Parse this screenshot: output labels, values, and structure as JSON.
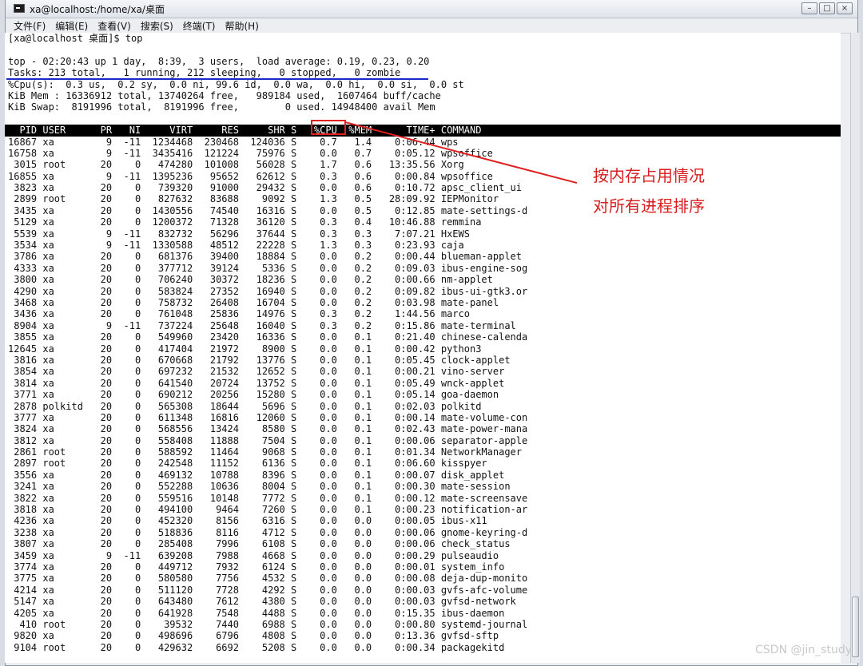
{
  "window": {
    "title": "xa@localhost:/home/xa/桌面",
    "buttons": [
      "–",
      "□",
      "×"
    ]
  },
  "menu": [
    "文件(F)",
    "编辑(E)",
    "查看(V)",
    "搜索(S)",
    "终端(T)",
    "帮助(H)"
  ],
  "terminal": {
    "prompt": "[xa@localhost 桌面]$ top",
    "summary": [
      "top - 02:20:43 up 1 day,  8:39,  3 users,  load average: 0.19, 0.23, 0.20",
      "Tasks: 213 total,   1 running, 212 sleeping,   0 stopped,   0 zombie",
      "%Cpu(s):  0.3 us,  0.2 sy,  0.0 ni, 99.6 id,  0.0 wa,  0.0 hi,  0.0 si,  0.0 st",
      "KiB Mem : 16336912 total, 13740264 free,   989184 used,  1607464 buff/cache",
      "KiB Swap:  8191996 total,  8191996 free,        0 used. 14948400 avail Mem"
    ],
    "columns": [
      "PID",
      "USER",
      "PR",
      "NI",
      "VIRT",
      "RES",
      "SHR",
      "S",
      "%CPU",
      "%MEM",
      "TIME+",
      "COMMAND"
    ],
    "rows": [
      [
        "16867",
        "xa",
        "9",
        "-11",
        "1234468",
        "230468",
        "124036",
        "S",
        "0.7",
        "1.4",
        "0:06.44",
        "wps"
      ],
      [
        "16758",
        "xa",
        "9",
        "-11",
        "3435416",
        "121224",
        "75976",
        "S",
        "0.0",
        "0.7",
        "0:05.12",
        "wpsoffice"
      ],
      [
        "3015",
        "root",
        "20",
        "0",
        "474280",
        "101008",
        "56028",
        "S",
        "1.7",
        "0.6",
        "13:35.56",
        "Xorg"
      ],
      [
        "16855",
        "xa",
        "9",
        "-11",
        "1395236",
        "95652",
        "62612",
        "S",
        "0.3",
        "0.6",
        "0:00.84",
        "wpsoffice"
      ],
      [
        "3823",
        "xa",
        "20",
        "0",
        "739320",
        "91000",
        "29432",
        "S",
        "0.0",
        "0.6",
        "0:10.72",
        "apsc_client_ui"
      ],
      [
        "2899",
        "root",
        "20",
        "0",
        "827632",
        "83688",
        "9092",
        "S",
        "1.3",
        "0.5",
        "28:09.92",
        "IEPMonitor"
      ],
      [
        "3435",
        "xa",
        "20",
        "0",
        "1430556",
        "74540",
        "16316",
        "S",
        "0.0",
        "0.5",
        "0:12.85",
        "mate-settings-d"
      ],
      [
        "5129",
        "xa",
        "20",
        "0",
        "1200372",
        "71328",
        "36120",
        "S",
        "0.3",
        "0.4",
        "10:46.88",
        "remmina"
      ],
      [
        "5539",
        "xa",
        "9",
        "-11",
        "832732",
        "56296",
        "37644",
        "S",
        "0.3",
        "0.3",
        "7:07.21",
        "HxEWS"
      ],
      [
        "3534",
        "xa",
        "9",
        "-11",
        "1330588",
        "48512",
        "22228",
        "S",
        "1.3",
        "0.3",
        "0:23.93",
        "caja"
      ],
      [
        "3786",
        "xa",
        "20",
        "0",
        "681376",
        "39400",
        "18884",
        "S",
        "0.0",
        "0.2",
        "0:00.44",
        "blueman-applet"
      ],
      [
        "4333",
        "xa",
        "20",
        "0",
        "377712",
        "39124",
        "5336",
        "S",
        "0.0",
        "0.2",
        "0:09.03",
        "ibus-engine-sog"
      ],
      [
        "3800",
        "xa",
        "20",
        "0",
        "706240",
        "30372",
        "18236",
        "S",
        "0.0",
        "0.2",
        "0:00.66",
        "nm-applet"
      ],
      [
        "4290",
        "xa",
        "20",
        "0",
        "583824",
        "27352",
        "16940",
        "S",
        "0.0",
        "0.2",
        "0:09.82",
        "ibus-ui-gtk3.or"
      ],
      [
        "3468",
        "xa",
        "20",
        "0",
        "758732",
        "26408",
        "16704",
        "S",
        "0.0",
        "0.2",
        "0:03.98",
        "mate-panel"
      ],
      [
        "3436",
        "xa",
        "20",
        "0",
        "761048",
        "25836",
        "14976",
        "S",
        "0.3",
        "0.2",
        "1:44.56",
        "marco"
      ],
      [
        "8904",
        "xa",
        "9",
        "-11",
        "737224",
        "25648",
        "16040",
        "S",
        "0.3",
        "0.2",
        "0:15.86",
        "mate-terminal"
      ],
      [
        "3855",
        "xa",
        "20",
        "0",
        "549960",
        "23420",
        "16336",
        "S",
        "0.0",
        "0.1",
        "0:21.40",
        "chinese-calenda"
      ],
      [
        "12645",
        "xa",
        "20",
        "0",
        "417404",
        "21972",
        "8900",
        "S",
        "0.0",
        "0.1",
        "0:00.42",
        "python3"
      ],
      [
        "3816",
        "xa",
        "20",
        "0",
        "670668",
        "21792",
        "13776",
        "S",
        "0.0",
        "0.1",
        "0:05.45",
        "clock-applet"
      ],
      [
        "3854",
        "xa",
        "20",
        "0",
        "697232",
        "21532",
        "12652",
        "S",
        "0.0",
        "0.1",
        "0:00.21",
        "vino-server"
      ],
      [
        "3814",
        "xa",
        "20",
        "0",
        "641540",
        "20724",
        "13752",
        "S",
        "0.0",
        "0.1",
        "0:05.49",
        "wnck-applet"
      ],
      [
        "3771",
        "xa",
        "20",
        "0",
        "690212",
        "20256",
        "15280",
        "S",
        "0.0",
        "0.1",
        "0:05.14",
        "goa-daemon"
      ],
      [
        "2878",
        "polkitd",
        "20",
        "0",
        "565308",
        "18644",
        "5696",
        "S",
        "0.0",
        "0.1",
        "0:02.03",
        "polkitd"
      ],
      [
        "3777",
        "xa",
        "20",
        "0",
        "611348",
        "16816",
        "12060",
        "S",
        "0.0",
        "0.1",
        "0:00.14",
        "mate-volume-con"
      ],
      [
        "3824",
        "xa",
        "20",
        "0",
        "568556",
        "13424",
        "8580",
        "S",
        "0.0",
        "0.1",
        "0:02.43",
        "mate-power-mana"
      ],
      [
        "3812",
        "xa",
        "20",
        "0",
        "558408",
        "11888",
        "7504",
        "S",
        "0.0",
        "0.1",
        "0:00.06",
        "separator-apple"
      ],
      [
        "2861",
        "root",
        "20",
        "0",
        "588592",
        "11464",
        "9068",
        "S",
        "0.0",
        "0.1",
        "0:01.34",
        "NetworkManager"
      ],
      [
        "2897",
        "root",
        "20",
        "0",
        "242548",
        "11152",
        "6136",
        "S",
        "0.0",
        "0.1",
        "0:06.60",
        "kisspyer"
      ],
      [
        "3556",
        "xa",
        "20",
        "0",
        "469132",
        "10788",
        "8396",
        "S",
        "0.0",
        "0.1",
        "0:00.07",
        "disk_applet"
      ],
      [
        "3241",
        "xa",
        "20",
        "0",
        "552288",
        "10636",
        "8004",
        "S",
        "0.0",
        "0.1",
        "0:00.30",
        "mate-session"
      ],
      [
        "3822",
        "xa",
        "20",
        "0",
        "559516",
        "10148",
        "7772",
        "S",
        "0.0",
        "0.1",
        "0:00.12",
        "mate-screensave"
      ],
      [
        "3818",
        "xa",
        "20",
        "0",
        "494100",
        "9464",
        "7260",
        "S",
        "0.0",
        "0.1",
        "0:00.23",
        "notification-ar"
      ],
      [
        "4236",
        "xa",
        "20",
        "0",
        "452320",
        "8156",
        "6316",
        "S",
        "0.0",
        "0.0",
        "0:00.05",
        "ibus-x11"
      ],
      [
        "3238",
        "xa",
        "20",
        "0",
        "518836",
        "8116",
        "4712",
        "S",
        "0.0",
        "0.0",
        "0:00.06",
        "gnome-keyring-d"
      ],
      [
        "3807",
        "xa",
        "20",
        "0",
        "285408",
        "7996",
        "6108",
        "S",
        "0.0",
        "0.0",
        "0:00.06",
        "check_status"
      ],
      [
        "3459",
        "xa",
        "9",
        "-11",
        "639208",
        "7988",
        "4668",
        "S",
        "0.0",
        "0.0",
        "0:00.29",
        "pulseaudio"
      ],
      [
        "3774",
        "xa",
        "20",
        "0",
        "449712",
        "7932",
        "6124",
        "S",
        "0.0",
        "0.0",
        "0:00.01",
        "system_info"
      ],
      [
        "3775",
        "xa",
        "20",
        "0",
        "580580",
        "7756",
        "4532",
        "S",
        "0.0",
        "0.0",
        "0:00.08",
        "deja-dup-monito"
      ],
      [
        "4214",
        "xa",
        "20",
        "0",
        "511120",
        "7728",
        "4292",
        "S",
        "0.0",
        "0.0",
        "0:00.03",
        "gvfs-afc-volume"
      ],
      [
        "5147",
        "xa",
        "20",
        "0",
        "643480",
        "7612",
        "4380",
        "S",
        "0.0",
        "0.0",
        "0:00.03",
        "gvfsd-network"
      ],
      [
        "4205",
        "xa",
        "20",
        "0",
        "641928",
        "7548",
        "4488",
        "S",
        "0.0",
        "0.0",
        "0:15.35",
        "ibus-daemon"
      ],
      [
        "410",
        "root",
        "20",
        "0",
        "39532",
        "7440",
        "6988",
        "S",
        "0.0",
        "0.0",
        "0:00.80",
        "systemd-journal"
      ],
      [
        "9820",
        "xa",
        "20",
        "0",
        "498696",
        "6796",
        "4808",
        "S",
        "0.0",
        "0.0",
        "0:13.36",
        "gvfsd-sftp"
      ],
      [
        "9104",
        "root",
        "20",
        "0",
        "429632",
        "6692",
        "5208",
        "S",
        "0.0",
        "0.0",
        "0:00.34",
        "packagekitd"
      ]
    ]
  },
  "annotation": {
    "line1": "按内存占用情况",
    "line2": "对所有进程排序"
  },
  "watermark": "CSDN @jin_study"
}
